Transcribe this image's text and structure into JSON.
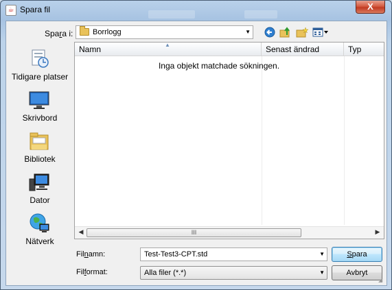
{
  "window": {
    "title": "Spara fil",
    "close_label": "X",
    "icon": "java-cup-icon"
  },
  "lookin": {
    "label_prefix": "Spa",
    "label_underlined": "r",
    "label_suffix": "a i:",
    "value": "Borrlogg"
  },
  "toolbar": {
    "back_icon": "back-arrow-icon",
    "up_icon": "folder-up-icon",
    "new_folder_icon": "new-folder-icon",
    "view_icon": "view-menu-icon"
  },
  "places": [
    {
      "label": "Tidigare platser",
      "icon": "recent-places-icon"
    },
    {
      "label": "Skrivbord",
      "icon": "desktop-icon"
    },
    {
      "label": "Bibliotek",
      "icon": "libraries-icon"
    },
    {
      "label": "Dator",
      "icon": "computer-icon"
    },
    {
      "label": "Nätverk",
      "icon": "network-icon"
    }
  ],
  "filelist": {
    "columns": [
      "Namn",
      "Senast ändrad",
      "Typ"
    ],
    "empty_message": "Inga objekt matchade sökningen.",
    "scroll_grip": "III"
  },
  "filename": {
    "label_prefix": "Fil",
    "label_underlined": "n",
    "label_suffix": "amn:",
    "value": "Test-Test3-CPT.std"
  },
  "fileformat": {
    "label_prefix": "Fil",
    "label_underlined": "f",
    "label_suffix": "ormat:",
    "value": "Alla filer (*.*)"
  },
  "buttons": {
    "save_underlined": "S",
    "save_rest": "para",
    "cancel": "Avbryt"
  },
  "colors": {
    "accent": "#3c7fb1",
    "close": "#c13a22"
  }
}
